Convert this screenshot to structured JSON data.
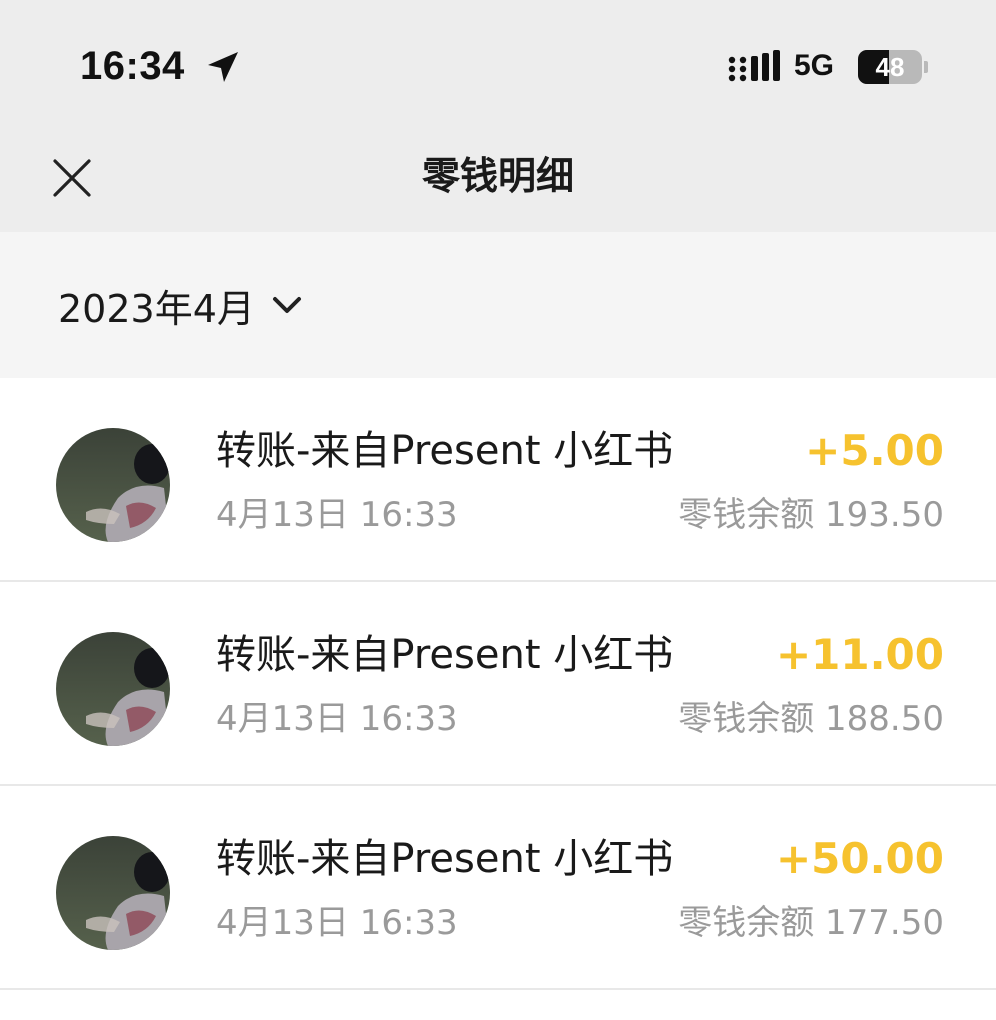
{
  "status_bar": {
    "time": "16:34",
    "network": "5G",
    "battery_level": 48,
    "battery_text": "48",
    "icons": [
      "location-arrow-icon",
      "signal-icon",
      "battery-icon"
    ]
  },
  "header": {
    "close_icon": "close-icon",
    "title": "零钱明细"
  },
  "filter": {
    "month": "2023年4月",
    "icon": "chevron-down-icon"
  },
  "colors": {
    "amount": "#f6c22e",
    "secondary_text": "#9a9a9a",
    "header_bg": "#ededed"
  },
  "transactions": [
    {
      "title": "转账-来自Present 小红书",
      "time": "4月13日 16:33",
      "amount": "+5.00",
      "balance": "零钱余额 193.50"
    },
    {
      "title": "转账-来自Present 小红书",
      "time": "4月13日 16:33",
      "amount": "+11.00",
      "balance": "零钱余额 188.50"
    },
    {
      "title": "转账-来自Present 小红书",
      "time": "4月13日 16:33",
      "amount": "+50.00",
      "balance": "零钱余额 177.50"
    }
  ]
}
